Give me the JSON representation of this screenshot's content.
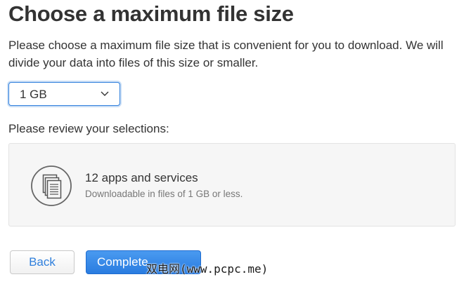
{
  "header": {
    "title": "Choose a maximum file size",
    "description": "Please choose a maximum file size that is convenient for you to download. We will divide your data into files of this size or smaller."
  },
  "file_size_select": {
    "selected": "1 GB",
    "icon": "chevron-down-icon"
  },
  "review": {
    "label": "Please review your selections:",
    "item": {
      "icon": "document-stack-icon",
      "title": "12 apps and services",
      "subtitle": "Downloadable in files of 1 GB or less."
    }
  },
  "actions": {
    "back_label": "Back",
    "complete_label": "Complete"
  },
  "watermark": {
    "text": "双电网(www.pcpc.me)"
  },
  "colors": {
    "accent": "#2f7fdc",
    "primary_button": "#2a7ce0",
    "card_background": "#f6f6f6"
  }
}
